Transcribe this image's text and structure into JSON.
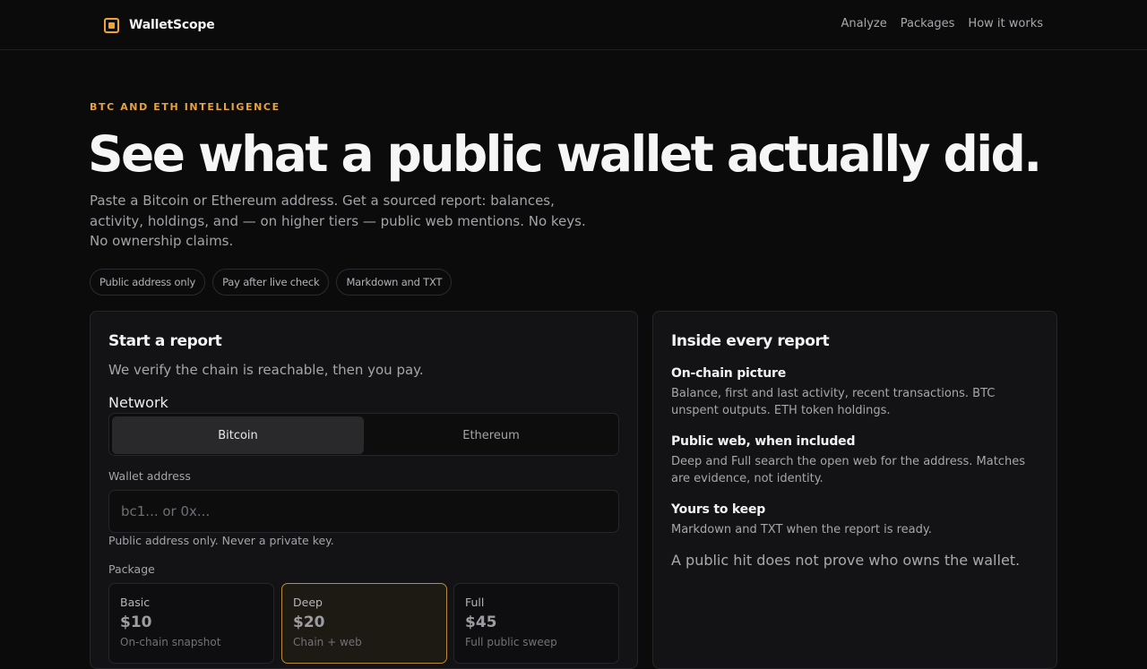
{
  "brand": {
    "name": "WalletScope",
    "accent_color": "#f0a52a",
    "icon": "square-logo-icon"
  },
  "nav": [
    {
      "label": "Analyze"
    },
    {
      "label": "Packages"
    },
    {
      "label": "How it works"
    }
  ],
  "hero": {
    "eyebrow": "BTC AND ETH INTELLIGENCE",
    "headline": "See what a public wallet actually did.",
    "subcopy": "Paste a Bitcoin or Ethereum address. Get a sourced report: balances, activity, holdings, and — on higher tiers — public web mentions. No keys. No ownership claims.",
    "pills": [
      "Public address only",
      "Pay after live check",
      "Markdown and TXT"
    ]
  },
  "report_form": {
    "title": "Start a report",
    "subtitle": "We verify the chain is reachable, then you pay.",
    "network_label": "Network",
    "networks": [
      {
        "label": "Bitcoin",
        "selected": true
      },
      {
        "label": "Ethereum",
        "selected": false
      }
    ],
    "address_label": "Wallet address",
    "address_placeholder": "bc1... or 0x...",
    "address_value": "",
    "address_hint": "Public address only. Never a private key.",
    "package_label": "Package",
    "packages": [
      {
        "name": "Basic",
        "price": "$10",
        "desc": "On-chain snapshot",
        "selected": false
      },
      {
        "name": "Deep",
        "price": "$20",
        "desc": "Chain + web",
        "selected": true
      },
      {
        "name": "Full",
        "price": "$45",
        "desc": "Full public sweep",
        "selected": false
      }
    ]
  },
  "report_info": {
    "title": "Inside every report",
    "features": [
      {
        "title": "On-chain picture",
        "body": "Balance, first and last activity, recent transactions. BTC unspent outputs. ETH token holdings."
      },
      {
        "title": "Public web, when included",
        "body": "Deep and Full search the open web for the address. Matches are evidence, not identity."
      },
      {
        "title": "Yours to keep",
        "body": "Markdown and TXT when the report is ready."
      }
    ],
    "disclaimer": "A public hit does not prove who owns the wallet."
  }
}
